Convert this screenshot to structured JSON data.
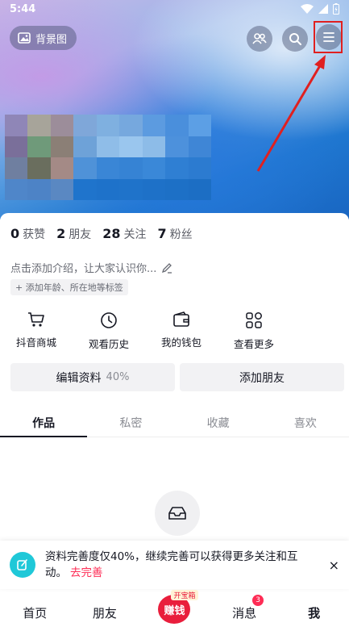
{
  "status_bar": {
    "time": "5:44"
  },
  "header": {
    "background_button_label": "背景图",
    "icons": [
      "image-icon",
      "friends-icon",
      "search-icon",
      "menu-icon"
    ]
  },
  "profile": {
    "stats": [
      {
        "value": "0",
        "label": "获赞"
      },
      {
        "value": "2",
        "label": "朋友"
      },
      {
        "value": "28",
        "label": "关注"
      },
      {
        "value": "7",
        "label": "粉丝"
      }
    ],
    "intro_placeholder": "点击添加介绍，让大家认识你...",
    "tag_prompt": "+ 添加年龄、所在地等标签"
  },
  "shortcuts": [
    {
      "label": "抖音商城",
      "icon": "cart-icon"
    },
    {
      "label": "观看历史",
      "icon": "clock-icon"
    },
    {
      "label": "我的钱包",
      "icon": "wallet-icon"
    },
    {
      "label": "查看更多",
      "icon": "grid-icon"
    }
  ],
  "actions": {
    "edit_profile": "编辑资料",
    "edit_profile_pct": "40%",
    "add_friend": "添加朋友"
  },
  "tabs": [
    "作品",
    "私密",
    "收藏",
    "喜欢"
  ],
  "banner": {
    "text": "资料完善度仅40%，继续完善可以获得更多关注和互动。",
    "link": "去完善",
    "close": "×"
  },
  "bottom_nav": {
    "home": "首页",
    "friends": "朋友",
    "earn": "赚钱",
    "earn_tag": "开宝箱",
    "messages": "消息",
    "messages_badge": "3",
    "me": "我"
  },
  "colors": {
    "accent": "#fe2c55",
    "annotation": "#e02020",
    "earn_red": "#e91e3c",
    "banner_icon": "#1fc8d8"
  }
}
